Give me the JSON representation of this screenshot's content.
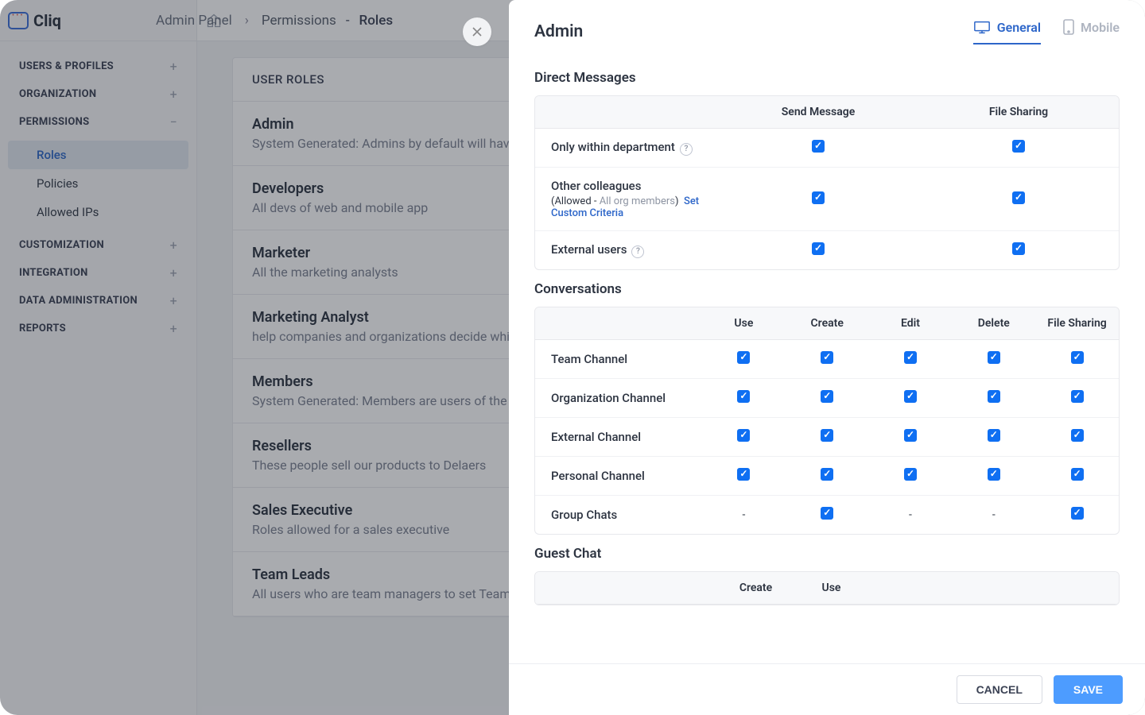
{
  "brand": "Cliq",
  "breadcrumb": {
    "root": "Admin Panel",
    "section": "Permissions",
    "current": "Roles"
  },
  "sidebar": {
    "sections": [
      {
        "label": "USERS & PROFILES",
        "toggle": "+"
      },
      {
        "label": "ORGANIZATION",
        "toggle": "+"
      },
      {
        "label": "PERMISSIONS",
        "toggle": "−",
        "items": [
          {
            "label": "Roles",
            "active": true
          },
          {
            "label": "Policies"
          },
          {
            "label": "Allowed IPs"
          }
        ]
      },
      {
        "label": "CUSTOMIZATION",
        "toggle": "+"
      },
      {
        "label": "INTEGRATION",
        "toggle": "+"
      },
      {
        "label": "DATA ADMINISTRATION",
        "toggle": "+"
      },
      {
        "label": "REPORTS",
        "toggle": "+"
      }
    ]
  },
  "rolesCard": {
    "heading": "USER ROLES",
    "rows": [
      {
        "title": "Admin",
        "desc": "System Generated: Admins by default will have"
      },
      {
        "title": "Developers",
        "desc": "All devs of web and mobile app"
      },
      {
        "title": "Marketer",
        "desc": "All the marketing analysts"
      },
      {
        "title": "Marketing Analyst",
        "desc": "help companies and organizations decide which"
      },
      {
        "title": "Members",
        "desc": "System Generated: Members are users of the o"
      },
      {
        "title": "Resellers",
        "desc": "These people sell our products to Delaers"
      },
      {
        "title": "Sales Executive",
        "desc": "Roles allowed for a sales executive"
      },
      {
        "title": "Team Leads",
        "desc": "All users who are team managers to set Team C"
      }
    ]
  },
  "panel": {
    "title": "Admin",
    "tabs": {
      "general": "General",
      "mobile": "Mobile"
    },
    "dm": {
      "heading": "Direct Messages",
      "cols": [
        "Send Message",
        "File Sharing"
      ],
      "rows": [
        {
          "label": "Only within department",
          "help": true,
          "vals": [
            "check",
            "check"
          ]
        },
        {
          "label": "Other colleagues",
          "sub_allowed": "(Allowed - ",
          "sub_members": "All org members",
          "sub_close": ")",
          "sub_link": "Set Custom Criteria",
          "vals": [
            "check",
            "check"
          ]
        },
        {
          "label": "External users",
          "help": true,
          "vals": [
            "check",
            "check"
          ]
        }
      ]
    },
    "conv": {
      "heading": "Conversations",
      "cols": [
        "Use",
        "Create",
        "Edit",
        "Delete",
        "File Sharing"
      ],
      "rows": [
        {
          "label": "Team Channel",
          "vals": [
            "check",
            "check",
            "check",
            "check",
            "check"
          ]
        },
        {
          "label": "Organization Channel",
          "vals": [
            "check",
            "check",
            "check",
            "check",
            "check"
          ]
        },
        {
          "label": "External Channel",
          "vals": [
            "check",
            "check",
            "check",
            "check",
            "check"
          ]
        },
        {
          "label": "Personal Channel",
          "vals": [
            "check",
            "check",
            "check",
            "check",
            "check"
          ]
        },
        {
          "label": "Group Chats",
          "vals": [
            "dash",
            "check",
            "dash",
            "dash",
            "check"
          ]
        }
      ]
    },
    "guest": {
      "heading": "Guest Chat",
      "cols": [
        "Create",
        "Use"
      ]
    },
    "buttons": {
      "cancel": "CANCEL",
      "save": "SAVE"
    }
  }
}
